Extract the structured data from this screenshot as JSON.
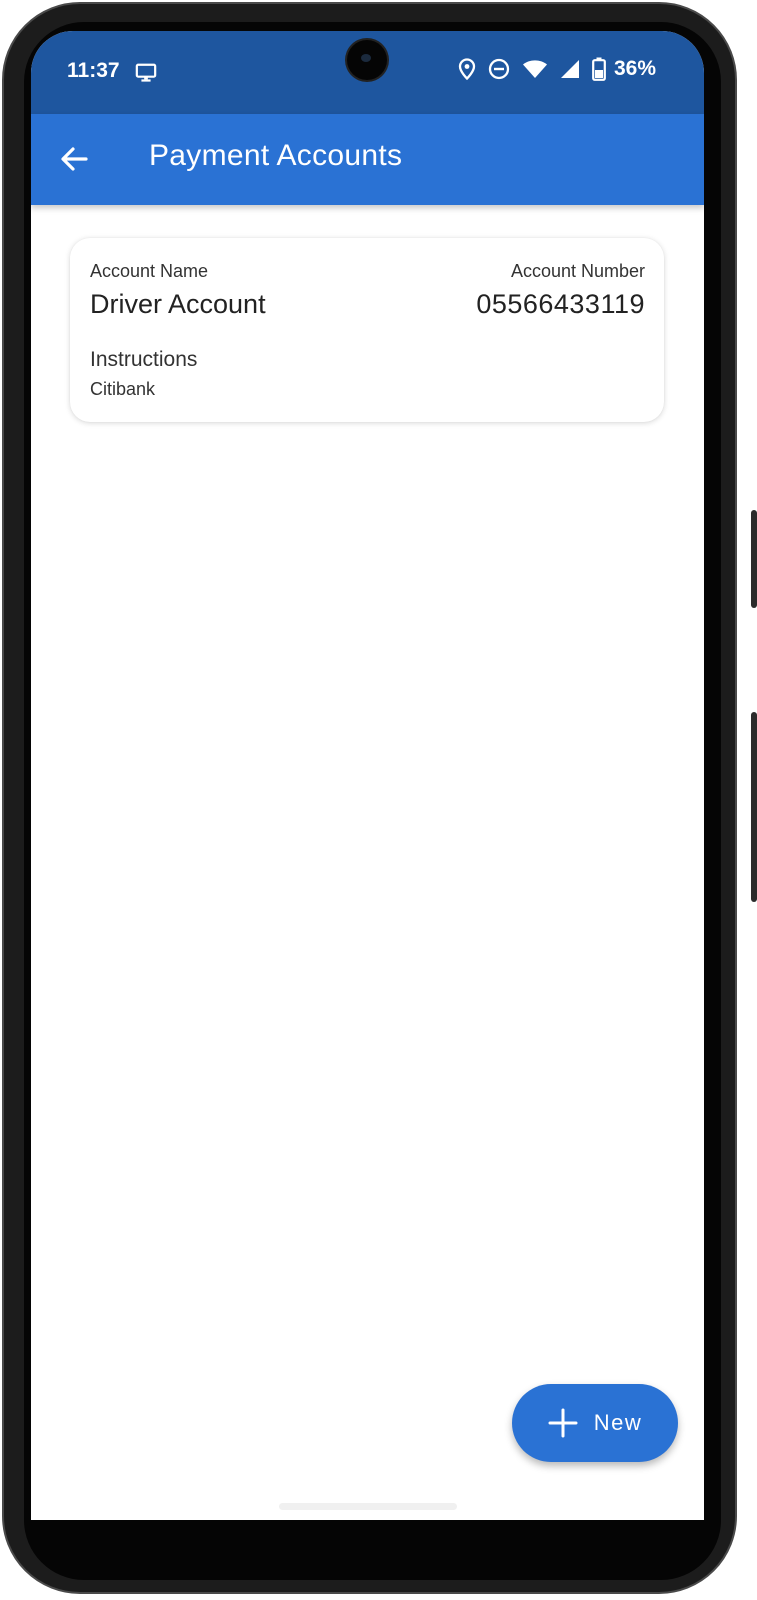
{
  "status_bar": {
    "time": "11:37",
    "battery_percent": "36%",
    "icons": [
      "monitor-icon",
      "location-icon",
      "do-not-disturb-icon",
      "wifi-icon",
      "signal-icon",
      "battery-icon"
    ]
  },
  "app_bar": {
    "title": "Payment Accounts",
    "back_icon": "arrow-back-icon"
  },
  "accounts": [
    {
      "name_label": "Account Name",
      "name": "Driver Account",
      "number_label": "Account Number",
      "number": "05566433119",
      "instructions_label": "Instructions",
      "instructions": "Citibank"
    }
  ],
  "fab": {
    "label": "New",
    "icon": "plus-icon"
  },
  "colors": {
    "status_bar": "#1e569f",
    "app_bar": "#2a72d4",
    "fab": "#2a72d4",
    "background": "#ffffff"
  }
}
